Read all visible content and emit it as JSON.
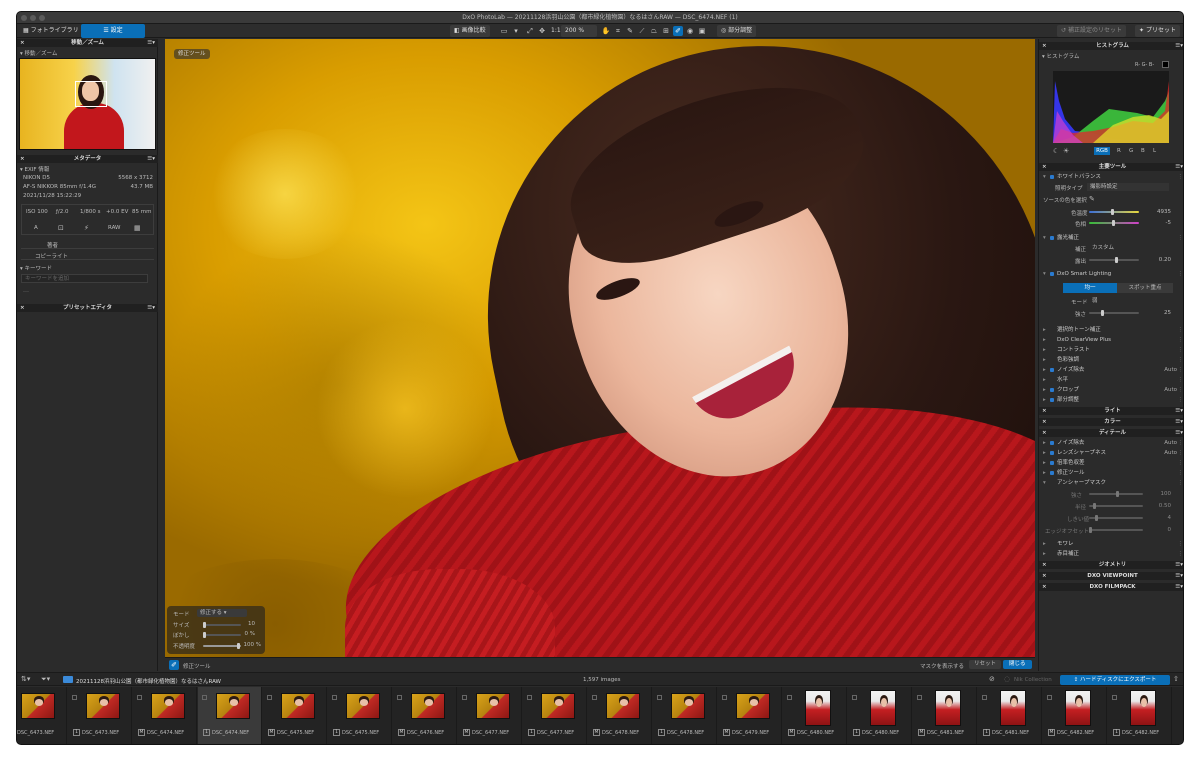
{
  "window": {
    "title": "DxO PhotoLab — 20211128浜羽山公園（都市緑化植物園）なるはさんRAW — DSC_6474.NEF (1)"
  },
  "toolbar": {
    "tab_library": "フォトライブラリ",
    "tab_customize": "設定",
    "compare": "画像比較",
    "zoom_fit": "1:1",
    "zoom_level": "200 %",
    "local_adjust": "部分調整",
    "reset_correction": "補正設定のリセット",
    "preset": "プリセット"
  },
  "left": {
    "move_zoom_header": "移動／ズーム",
    "move_zoom_sub": "移動／ズーム",
    "meta_header": "メタデータ",
    "exif_label": "EXIF 情報",
    "camera": "NIKON D5",
    "dims": "5568 x 3712",
    "lens": "AF-S NIKKOR 85mm f/1.4G",
    "size": "43.7 MB",
    "date": "2021/11/28 15:22:29",
    "iso": "ISO 100",
    "aperture": "ƒ/2.0",
    "shutter": "1/800 s",
    "ev": "+0.0 EV",
    "focal": "85 mm",
    "mode_a": "A",
    "raw": "RAW",
    "author": "著者",
    "copyright": "コピーライト",
    "keyword_header": "キーワード",
    "keyword_placeholder": "キーワードを追加",
    "dash": "---",
    "preset_header": "プリセットエディタ"
  },
  "center": {
    "badge": "修正ツール",
    "rt_mode_label": "モード",
    "rt_mode_value": "修正する",
    "rt_size_label": "サイズ",
    "rt_size_value": "10",
    "rt_blur_label": "ぼかし",
    "rt_blur_value": "0 %",
    "rt_opacity_label": "不透明度",
    "rt_opacity_value": "100 %",
    "tool_name": "修正ツール",
    "show_mask": "マスクを表示する",
    "reset": "リセット",
    "close": "閉じる"
  },
  "right": {
    "hist_header": "ヒストグラム",
    "hist_sub": "ヒストグラム",
    "hist_rgb_values": "R- G- B-",
    "channels": [
      "RGB",
      "R",
      "G",
      "B",
      "L"
    ],
    "essential": "主要ツール",
    "wb": "ホワイトバランス",
    "wb_type_label": "照明タイプ",
    "wb_type_value": "撮影時設定",
    "wb_src": "ソースの色を選択",
    "wb_temp_label": "色温度",
    "wb_temp_value": "4935",
    "wb_tint_label": "色相",
    "wb_tint_value": "-5",
    "expo": "露光補正",
    "expo_corr_label": "補正",
    "expo_corr_value": "カスタム",
    "expo_amt_label": "露出",
    "expo_amt_value": "0.20",
    "smart": "DxO Smart Lighting",
    "smart_uniform": "均一",
    "smart_spot": "スポット重点",
    "smart_mode_label": "モード",
    "smart_mode_value": "弱",
    "smart_str_label": "強さ",
    "smart_str_value": "25",
    "tone": "選択的トーン補正",
    "clearview": "DxO ClearView Plus",
    "contrast": "コントラスト",
    "color_accent": "色彩強調",
    "noise": "ノイズ除去",
    "noise_value": "Auto",
    "horizon": "水平",
    "crop": "クロップ",
    "crop_value": "Auto",
    "local": "部分調整",
    "light": "ライト",
    "color": "カラー",
    "detail": "ディテール",
    "d_noise": "ノイズ除去",
    "d_noise_value": "Auto",
    "d_lens": "レンズシャープネス",
    "d_lens_value": "Auto",
    "d_chroma": "倍率色収差",
    "d_repair": "修正ツール",
    "d_unsharp": "アンシャープマスク",
    "us_strength_label": "強さ",
    "us_strength_value": "100",
    "us_radius_label": "半径",
    "us_radius_value": "0.50",
    "us_thresh_label": "しきい値",
    "us_thresh_value": "4",
    "us_edge_label": "エッジオフセット",
    "us_edge_value": "0",
    "moire": "モワレ",
    "redeye": "赤目補正",
    "geometry": "ジオメトリ",
    "viewpoint": "DXO VIEWPOINT",
    "filmpack": "DXO FILMPACK"
  },
  "filmstrip": {
    "folder": "20211128浜羽山公園（都市緑化植物園）なるはさんRAW",
    "count": "1,597 images",
    "nik": "Nik Collection",
    "export": "ハードディスクにエクスポート",
    "items": [
      {
        "badge": "",
        "name": "DSC_6473.NEF"
      },
      {
        "badge": "1",
        "name": "DSC_6473.NEF"
      },
      {
        "badge": "M",
        "name": "DSC_6474.NEF"
      },
      {
        "badge": "1",
        "name": "DSC_6474.NEF"
      },
      {
        "badge": "M",
        "name": "DSC_6475.NEF"
      },
      {
        "badge": "1",
        "name": "DSC_6475.NEF"
      },
      {
        "badge": "M",
        "name": "DSC_6476.NEF"
      },
      {
        "badge": "M",
        "name": "DSC_6477.NEF"
      },
      {
        "badge": "1",
        "name": "DSC_6477.NEF"
      },
      {
        "badge": "M",
        "name": "DSC_6478.NEF"
      },
      {
        "badge": "1",
        "name": "DSC_6478.NEF"
      },
      {
        "badge": "M",
        "name": "DSC_6479.NEF"
      },
      {
        "badge": "M",
        "name": "DSC_6480.NEF"
      },
      {
        "badge": "1",
        "name": "DSC_6480.NEF"
      },
      {
        "badge": "M",
        "name": "DSC_6481.NEF"
      },
      {
        "badge": "1",
        "name": "DSC_6481.NEF"
      },
      {
        "badge": "M",
        "name": "DSC_6482.NEF"
      },
      {
        "badge": "1",
        "name": "DSC_6482.NEF"
      }
    ]
  },
  "colors": {
    "accent": "#0a6fb8",
    "hist_red": "#e03030",
    "hist_green": "#4dd04d",
    "hist_blue": "#4040ff"
  }
}
